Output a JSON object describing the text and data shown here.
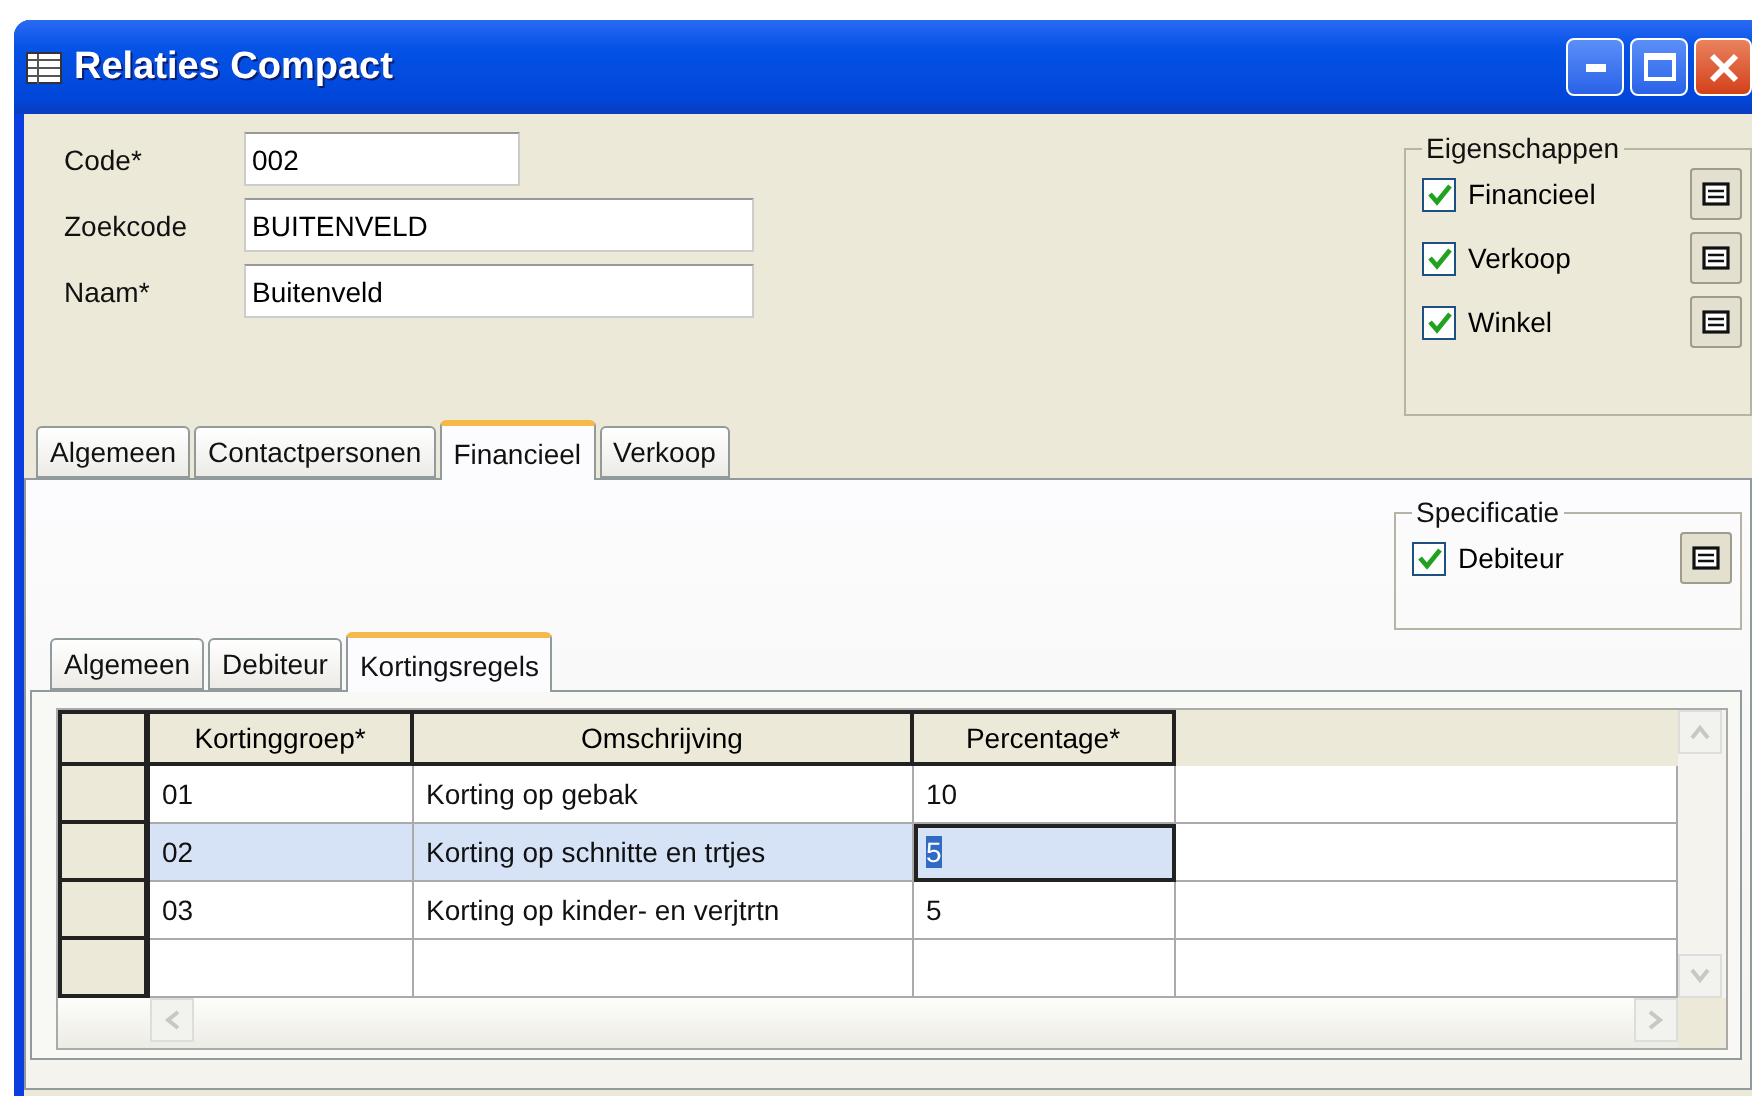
{
  "window": {
    "title": "Relaties Compact"
  },
  "fields": [
    {
      "label": "Code*",
      "value": "002",
      "wide": false
    },
    {
      "label": "Zoekcode",
      "value": "BUITENVELD",
      "wide": true
    },
    {
      "label": "Naam*",
      "value": "Buitenveld",
      "wide": true
    }
  ],
  "eigenschappen": {
    "title": "Eigenschappen",
    "items": [
      {
        "label": "Financieel",
        "checked": true
      },
      {
        "label": "Verkoop",
        "checked": true
      },
      {
        "label": "Winkel",
        "checked": true
      }
    ]
  },
  "tabs": [
    {
      "label": "Algemeen",
      "selected": false
    },
    {
      "label": "Contactpersonen",
      "selected": false
    },
    {
      "label": "Financieel",
      "selected": true
    },
    {
      "label": "Verkoop",
      "selected": false
    }
  ],
  "specificatie": {
    "title": "Specificatie",
    "items": [
      {
        "label": "Debiteur",
        "checked": true
      }
    ]
  },
  "subtabs": [
    {
      "label": "Algemeen",
      "selected": false
    },
    {
      "label": "Debiteur",
      "selected": false
    },
    {
      "label": "Kortingsregels",
      "selected": true
    }
  ],
  "table": {
    "columns": [
      "Kortinggroep*",
      "Omschrijving",
      "Percentage*"
    ],
    "rows": [
      {
        "cells": [
          "01",
          "Korting op gebak",
          "10"
        ],
        "selected": false
      },
      {
        "cells": [
          "02",
          "Korting op schnitte en trtjes",
          "5"
        ],
        "selected": true
      },
      {
        "cells": [
          "03",
          "Korting op kinder- en verjtrtn",
          "5"
        ],
        "selected": false
      }
    ]
  }
}
